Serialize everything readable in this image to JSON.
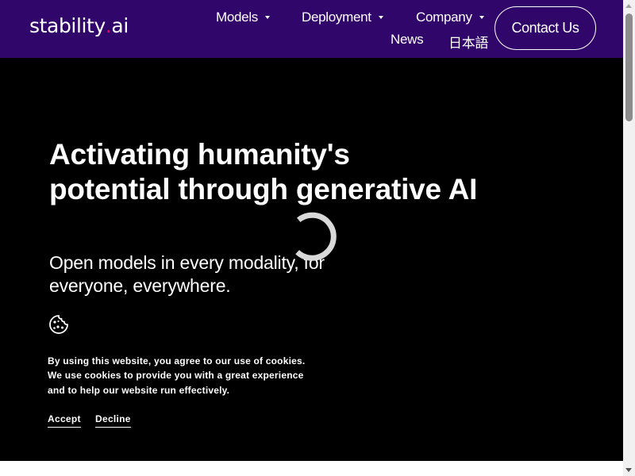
{
  "colors": {
    "header_bg": "#30066b",
    "hero_bg": "#000000",
    "text": "#ffffff",
    "logo_dot": "#e80a4c",
    "spinner": "#d9d9d9"
  },
  "header": {
    "logo_text_before": "stability",
    "logo_dot": ".",
    "logo_text_after": "ai",
    "nav": [
      {
        "label": "Models",
        "has_dropdown": true
      },
      {
        "label": "Deployment",
        "has_dropdown": true
      },
      {
        "label": "Company",
        "has_dropdown": true
      },
      {
        "label": "News",
        "has_dropdown": false
      },
      {
        "label": "日本語",
        "has_dropdown": false
      }
    ],
    "contact_label": "Contact Us"
  },
  "hero": {
    "title": "Activating humanity's potential through generative AI",
    "subtitle": "Open models in every modality, for everyone, everywhere."
  },
  "loading_indicator": {
    "icon": "spinner-icon"
  },
  "cookie_banner": {
    "icon": "cookie-icon",
    "text": "By using this website, you agree to our use of cookies. We use cookies to provide you with a great experience and to help our website run effectively.",
    "accept_label": "Accept",
    "decline_label": "Decline"
  }
}
